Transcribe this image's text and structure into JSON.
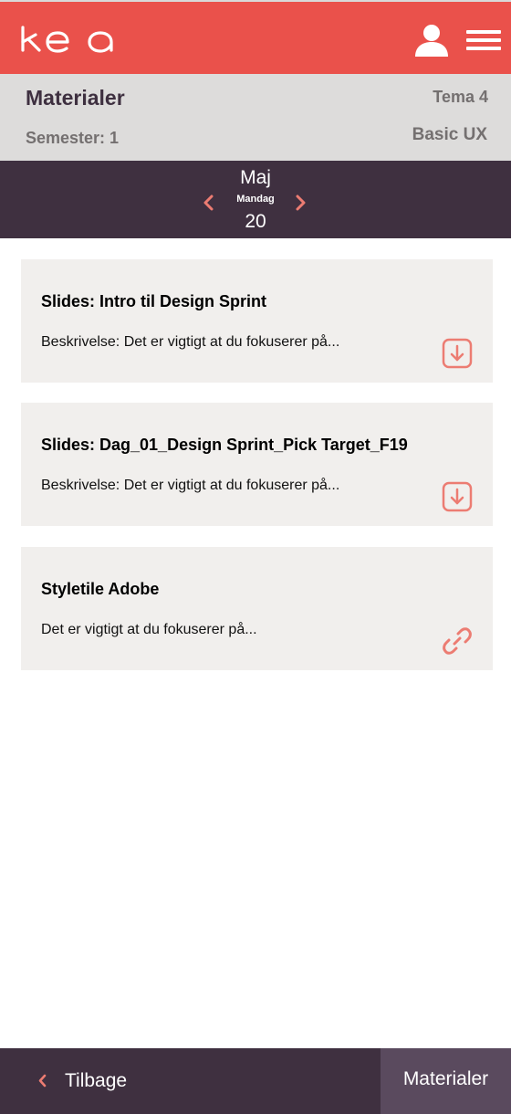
{
  "header": {
    "logo_text": "kea",
    "user_icon": "user-icon",
    "menu_icon": "hamburger-menu-icon"
  },
  "info": {
    "title": "Materialer",
    "semester": "Semester: 1",
    "tema": "Tema 4",
    "course": "Basic UX"
  },
  "date": {
    "month": "Maj",
    "weekday": "Mandag",
    "day": "20",
    "prev_icon": "chevron-left-icon",
    "next_icon": "chevron-right-icon"
  },
  "materials": [
    {
      "title": "Slides: Intro til Design Sprint",
      "description": "Beskrivelse: Det er vigtigt at du fokuserer på...",
      "icon": "download-icon"
    },
    {
      "title": "Slides: Dag_01_Design Sprint_Pick Target_F19",
      "description": "Beskrivelse: Det er vigtigt at du fokuserer på...",
      "icon": "download-icon"
    },
    {
      "title": "Styletile Adobe",
      "description": "Det er vigtigt at du fokuserer på...",
      "icon": "link-icon"
    }
  ],
  "footer": {
    "back_label": "Tilbage",
    "current_label": "Materialer"
  },
  "colors": {
    "brand_red": "#ea514b",
    "dark_purple": "#3f3040",
    "icon_accent": "#ec7c72"
  }
}
